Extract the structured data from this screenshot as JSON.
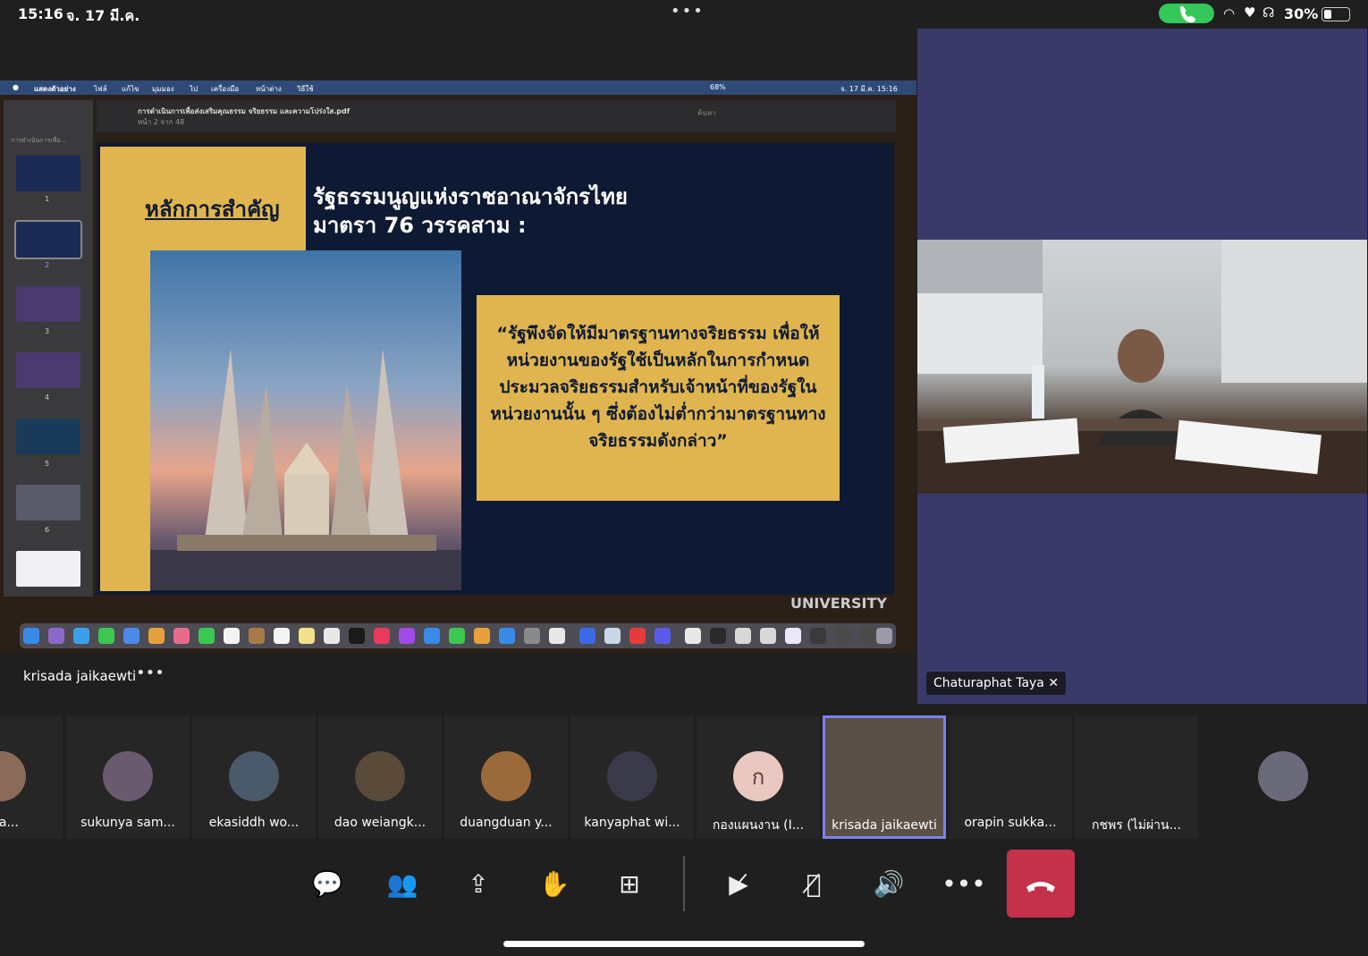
{
  "status_bar": {
    "time": "15:16",
    "date": "จ. 17 มี.ค.",
    "battery": "30%"
  },
  "share": {
    "menubar": [
      "แสดงตัวอย่าง",
      "ไฟล์",
      "แก้ไข",
      "มุมมอง",
      "ไป",
      "เครื่องมือ",
      "หน้าต่าง",
      "วิธีใช้"
    ],
    "menubar_right": "จ. 17 มี.ค. 15:16",
    "battery": "68%",
    "file_name": "การดำเนินการเพื่อส่งเสริมคุณธรรม จริยธรรม และความโปร่งใส.pdf",
    "page_info": "หน้า 2 จาก 48",
    "search_placeholder": "ค้นหา",
    "sidebar_header": "การดำเนินการเพื่อ...",
    "thumbs": [
      "1",
      "2",
      "3",
      "4",
      "5",
      "6"
    ],
    "slide": {
      "heading": "หลักการสำคัญ",
      "title_line1": "รัฐธรรมนูญแห่งราชอาณาจักรไทย",
      "title_line2": "มาตรา 76 วรรคสาม :",
      "quote": "“รัฐพึงจัดให้มีมาตรฐานทางจริยธรรม เพื่อให้หน่วยงานของรัฐใช้เป็นหลักในการกำหนดประมวลจริยธรรมสำหรับเจ้าหน้าที่ของรัฐในหน่วยงานนั้น ๆ ซึ่งต้องไม่ต่ำกว่ามาตรฐานทางจริยธรรมดังกล่าว”"
    },
    "background_text": "UNIVERSITY",
    "presenter": "krisada jaikaewti"
  },
  "pinned": {
    "name": "Chaturaphat Taya"
  },
  "participants": [
    {
      "name": "pha...",
      "color": "#8a6a5a"
    },
    {
      "name": "sukunya sam...",
      "color": "#6a5a70"
    },
    {
      "name": "ekasiddh wo...",
      "color": "#4a5a6a"
    },
    {
      "name": "dao weiangk...",
      "color": "#5a4a3a"
    },
    {
      "name": "duangduan y...",
      "color": "#9a6a3a"
    },
    {
      "name": "kanyaphat wi...",
      "color": "#3a3a4a"
    },
    {
      "name": "กองแผนงาน (I...",
      "initial": "ก",
      "color": "#e8c8c0"
    },
    {
      "name": "krisada jaikaewti",
      "color": "#5a5048",
      "active": true
    },
    {
      "name": "orapin sukka...",
      "color": "#111111"
    },
    {
      "name": "กชพร (ไม่ผ่าน...",
      "color": "#111111"
    },
    {
      "name": "",
      "color": "#6a6a7a"
    }
  ],
  "controls": [
    "chat",
    "people",
    "share",
    "raise-hand",
    "apps",
    "camera-off",
    "mic-off",
    "speaker",
    "more"
  ]
}
